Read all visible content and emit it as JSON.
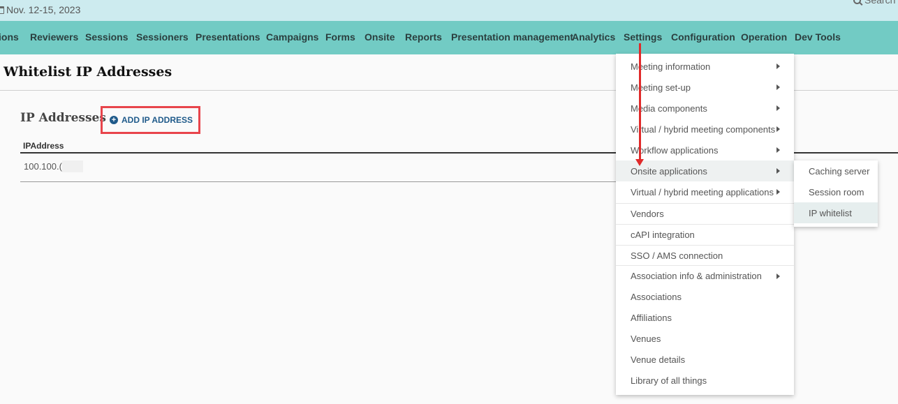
{
  "topbar": {
    "date": "Nov. 12-15, 2023",
    "search_label": "Search"
  },
  "nav": {
    "items": [
      "ions",
      "Reviewers",
      "Sessions",
      "Sessioners",
      "Presentations",
      "Campaigns",
      "Forms",
      "Onsite",
      "Reports",
      "Presentation management",
      "Analytics",
      "Settings",
      "Configuration",
      "Operation",
      "Dev Tools"
    ]
  },
  "page": {
    "title": "Whitelist IP Addresses",
    "section_title": "IP Addresses",
    "add_button_label": "ADD IP ADDRESS"
  },
  "table": {
    "columns": [
      "IPAddress"
    ],
    "rows": [
      [
        "100.100.("
      ]
    ]
  },
  "settings_menu": {
    "items": [
      "Meeting information",
      "Meeting set-up",
      "Media components",
      "Virtual / hybrid meeting components",
      "Workflow applications",
      "Onsite applications",
      "Virtual / hybrid meeting applications",
      "Vendors",
      "cAPI integration",
      "SSO / AMS connection",
      "Association info & administration",
      "Associations",
      "Affiliations",
      "Venues",
      "Venue details",
      "Library of all things"
    ],
    "active": "Onsite applications"
  },
  "submenu": {
    "items": [
      "Caching server",
      "Session room",
      "IP whitelist"
    ],
    "active": "IP whitelist"
  },
  "colors": {
    "topbar": "#cdebef",
    "navbar": "#72cbc4",
    "accent_link": "#1f5a8a",
    "annotation_red": "#e02a2a"
  }
}
